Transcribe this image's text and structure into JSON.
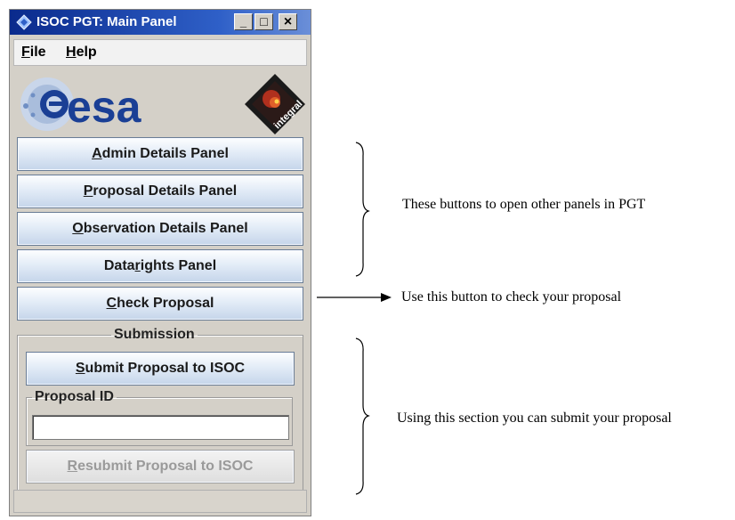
{
  "window": {
    "title": "ISOC PGT: Main Panel",
    "controls": {
      "minimize": "_",
      "maximize": "□",
      "close": "×"
    }
  },
  "menu": [
    {
      "label": "File",
      "mnemonic": "F",
      "rest": "ile"
    },
    {
      "label": "Help",
      "mnemonic": "H",
      "rest": "elp"
    }
  ],
  "logos": {
    "left": "esa",
    "right": "integral",
    "left_logo_color": "#1a3f95",
    "right_logo_color": "#1a1a1a"
  },
  "buttons": [
    {
      "label": "Admin Details Panel",
      "pre": "",
      "mn": "A",
      "post": "dmin Details Panel"
    },
    {
      "label": "Proposal Details Panel",
      "pre": "",
      "mn": "P",
      "post": "roposal Details Panel"
    },
    {
      "label": "Observation Details Panel",
      "pre": "",
      "mn": "O",
      "post": "bservation Details Panel"
    },
    {
      "label": "Data rights Panel",
      "pre": "Data ",
      "mn": "r",
      "post": "ights Panel"
    },
    {
      "label": "Check Proposal",
      "pre": "",
      "mn": "C",
      "post": "heck Proposal"
    }
  ],
  "submission": {
    "legend": "Submission",
    "submit_button": {
      "label": "Submit Proposal to ISOC",
      "pre": "",
      "mn": "S",
      "post": "ubmit Proposal to ISOC"
    },
    "proposal_id": {
      "legend": "Proposal ID",
      "value": ""
    },
    "resubmit_button": {
      "label": "Resubmit Proposal to ISOC",
      "pre": "",
      "mn": "R",
      "post": "esubmit Proposal to ISOC",
      "enabled": false
    }
  },
  "annotations": {
    "panels_note": "These buttons to open other panels in PGT",
    "check_note": "Use this button to check your proposal",
    "submit_note": "Using this section you can submit your proposal"
  },
  "colors": {
    "title_bar": "#0a2a8c",
    "button_gradient_top": "#fdfeff",
    "button_gradient_bottom": "#c5d5ea",
    "window_bg": "#d4d0c8"
  }
}
